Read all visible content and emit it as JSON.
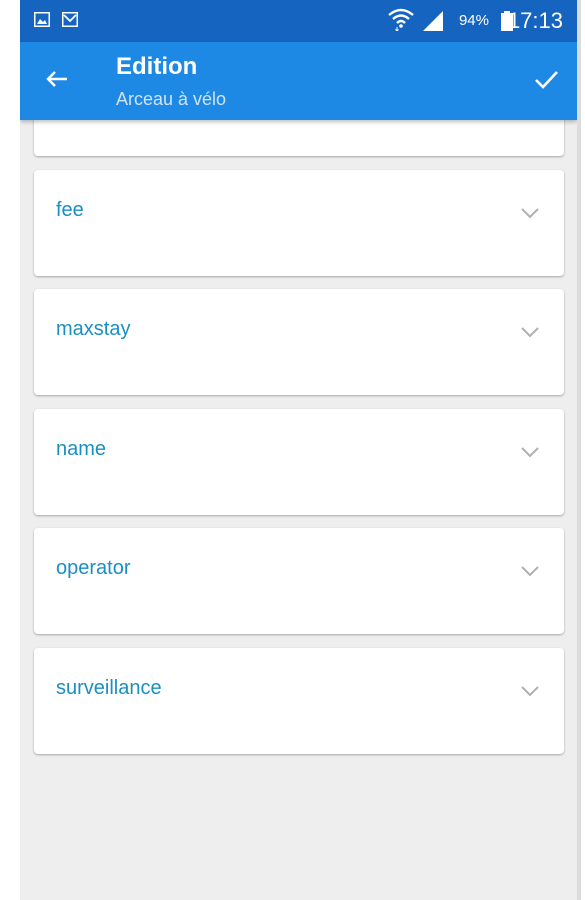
{
  "status_bar": {
    "left_icons": [
      "gallery-icon",
      "mail-icon"
    ],
    "wifi_icon": "wifi-icon",
    "signal_icon": "signal-icon",
    "battery_percent": "94%",
    "battery_icon": "battery-icon",
    "time": "17:13"
  },
  "app_bar": {
    "back_icon": "arrow-back-icon",
    "title": "Edition",
    "subtitle": "Arceau à vélo",
    "confirm_icon": "check-icon"
  },
  "fields": [
    {
      "label": "fee"
    },
    {
      "label": "maxstay"
    },
    {
      "label": "name"
    },
    {
      "label": "operator"
    },
    {
      "label": "surveillance"
    }
  ],
  "colors": {
    "status_bar": "#1565c0",
    "app_bar": "#1e88e5",
    "field_label": "#1a8fc2",
    "background": "#eeeeee"
  }
}
